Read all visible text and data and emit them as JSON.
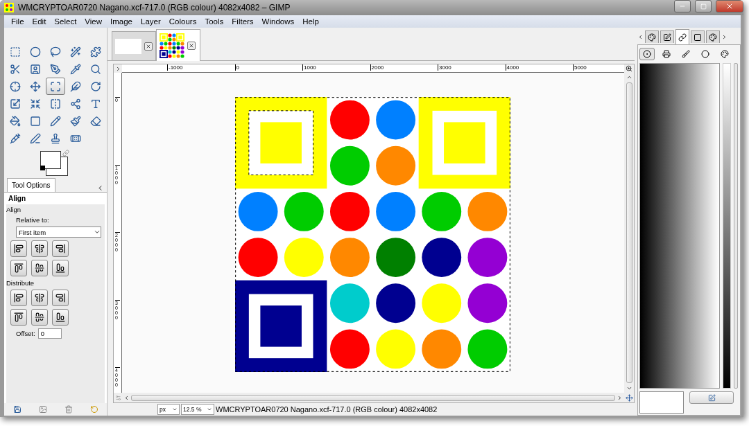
{
  "window": {
    "title": "WMCRYPTOAR0720 Nagano.xcf-717.0 (RGB colour) 4082x4082 – GIMP"
  },
  "menu": [
    "File",
    "Edit",
    "Select",
    "View",
    "Image",
    "Layer",
    "Colours",
    "Tools",
    "Filters",
    "Windows",
    "Help"
  ],
  "tools": [
    {
      "selected": false
    },
    {
      "selected": false
    },
    {
      "selected": false
    },
    {
      "selected": false
    },
    {
      "selected": false
    },
    {
      "selected": false
    },
    {
      "selected": false
    },
    {
      "selected": false
    },
    {
      "selected": false
    },
    {
      "selected": false
    },
    {
      "selected": false
    },
    {
      "selected": false
    },
    {
      "selected": true
    },
    {
      "selected": false
    },
    {
      "selected": false
    },
    {
      "selected": false
    },
    {
      "selected": false
    },
    {
      "selected": false
    },
    {
      "selected": false
    },
    {
      "selected": false
    },
    {
      "selected": false
    },
    {
      "selected": false
    },
    {
      "selected": false
    },
    {
      "selected": false
    },
    {
      "selected": false
    },
    {
      "selected": false
    },
    {
      "selected": false
    },
    {
      "selected": false
    },
    {
      "selected": false
    }
  ],
  "tool_options": {
    "tab": "Tool Options",
    "title": "Align",
    "section": "Align",
    "relative_label": "Relative to:",
    "relative_value": "First item",
    "distribute_label": "Distribute",
    "offset_label": "Offset:",
    "offset_value": "0"
  },
  "image_tabs": [
    {
      "selected": false
    },
    {
      "selected": true
    }
  ],
  "ruler": {
    "horizontal": [
      "-1000",
      "0",
      "1000",
      "2000",
      "3000",
      "4000",
      "5000"
    ],
    "vertical": [
      "0",
      "1000",
      "2000",
      "3000",
      "4000"
    ]
  },
  "image": {
    "frames": [
      {
        "color": "#ffff00"
      },
      {
        "color": "#ffff00"
      },
      {
        "color": "#000090"
      }
    ],
    "rows": [
      [
        {
          "kind": "blank"
        },
        {
          "kind": "blank"
        },
        {
          "kind": "circle",
          "color": "#ff0000"
        },
        {
          "kind": "circle",
          "color": "#0080ff"
        },
        {
          "kind": "blank"
        },
        {
          "kind": "blank"
        }
      ],
      [
        {
          "kind": "blank"
        },
        {
          "kind": "blank"
        },
        {
          "kind": "circle",
          "color": "#00cc00"
        },
        {
          "kind": "circle",
          "color": "#ff8800"
        },
        {
          "kind": "blank"
        },
        {
          "kind": "blank"
        }
      ],
      [
        {
          "kind": "circle",
          "color": "#0080ff"
        },
        {
          "kind": "circle",
          "color": "#00cc00"
        },
        {
          "kind": "circle",
          "color": "#ff0000"
        },
        {
          "kind": "circle",
          "color": "#0080ff"
        },
        {
          "kind": "circle",
          "color": "#00cc00"
        },
        {
          "kind": "circle",
          "color": "#ff8800"
        }
      ],
      [
        {
          "kind": "circle",
          "color": "#ff0000"
        },
        {
          "kind": "circle",
          "color": "#ffff00"
        },
        {
          "kind": "circle",
          "color": "#ff8800"
        },
        {
          "kind": "circle",
          "color": "#008000"
        },
        {
          "kind": "circle",
          "color": "#000090"
        },
        {
          "kind": "circle",
          "color": "#9400d3"
        }
      ],
      [
        {
          "kind": "blank"
        },
        {
          "kind": "blank"
        },
        {
          "kind": "circle",
          "color": "#00cccc"
        },
        {
          "kind": "circle",
          "color": "#000090"
        },
        {
          "kind": "circle",
          "color": "#ffff00"
        },
        {
          "kind": "circle",
          "color": "#9400d3"
        }
      ],
      [
        {
          "kind": "blank"
        },
        {
          "kind": "blank"
        },
        {
          "kind": "circle",
          "color": "#ff0000"
        },
        {
          "kind": "circle",
          "color": "#ffff00"
        },
        {
          "kind": "circle",
          "color": "#ff8800"
        },
        {
          "kind": "circle",
          "color": "#00cc00"
        }
      ]
    ]
  },
  "status_bar": {
    "unit": "px",
    "zoom": "12.5 %",
    "text": "WMCRYPTOAR0720 Nagano.xcf-717.0 (RGB colour) 4082x4082"
  },
  "dock_tabs": [
    {
      "selected": false
    },
    {
      "selected": false
    },
    {
      "selected": true
    },
    {
      "selected": false
    },
    {
      "selected": false
    }
  ],
  "dock_subtabs": [
    {
      "selected": true
    },
    {
      "selected": false
    },
    {
      "selected": false
    },
    {
      "selected": false
    },
    {
      "selected": false
    }
  ]
}
